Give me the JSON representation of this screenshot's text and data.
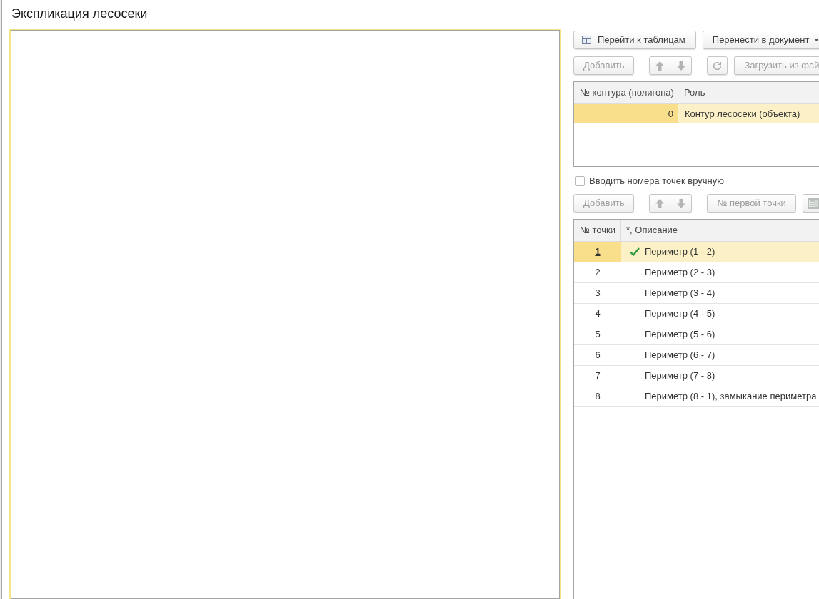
{
  "title": "Экспликация лесосеки",
  "top_toolbar": [
    {
      "kind": "icon_text",
      "label": "Перейти к таблицам",
      "disabled": false
    },
    {
      "kind": "dropdown",
      "label": "Перенести в документ",
      "disabled": false
    }
  ],
  "contours_toolbar": [
    {
      "kind": "button",
      "label": "Добавить",
      "disabled": true
    },
    {
      "kind": "arrows",
      "disabled": true
    },
    {
      "kind": "refresh",
      "disabled": true
    },
    {
      "kind": "button",
      "label": "Загрузить из фай",
      "disabled": true
    }
  ],
  "contours_table": {
    "columns": [
      "№ контура (полигона)",
      "Роль"
    ],
    "rows": [
      {
        "cells": [
          "0",
          "Контур лесосеки (объекта)"
        ],
        "selected": true
      }
    ]
  },
  "manual_numbers": {
    "label": "Вводить номера точек вручную",
    "checked": false
  },
  "points_toolbar": [
    {
      "kind": "button",
      "label": "Добавить",
      "disabled": true
    },
    {
      "kind": "arrows",
      "disabled": true
    },
    {
      "kind": "button",
      "label": "№ первой точки",
      "disabled": true
    },
    {
      "kind": "export",
      "disabled": true
    }
  ],
  "points_table": {
    "columns": [
      "№ точки",
      "*, Описание"
    ],
    "rows": [
      {
        "number": "1",
        "checked": true,
        "description": "Периметр (1 - 2)",
        "selected": true
      },
      {
        "number": "2",
        "checked": false,
        "description": "Периметр (2 - 3)",
        "selected": false
      },
      {
        "number": "3",
        "checked": false,
        "description": "Периметр (3 - 4)",
        "selected": false
      },
      {
        "number": "4",
        "checked": false,
        "description": "Периметр (4 - 5)",
        "selected": false
      },
      {
        "number": "5",
        "checked": false,
        "description": "Периметр (5 - 6)",
        "selected": false
      },
      {
        "number": "6",
        "checked": false,
        "description": "Периметр (6 - 7)",
        "selected": false
      },
      {
        "number": "7",
        "checked": false,
        "description": "Периметр (7 - 8)",
        "selected": false
      },
      {
        "number": "8",
        "checked": false,
        "description": "Периметр (8 - 1), замыкание периметра",
        "selected": false
      }
    ]
  }
}
